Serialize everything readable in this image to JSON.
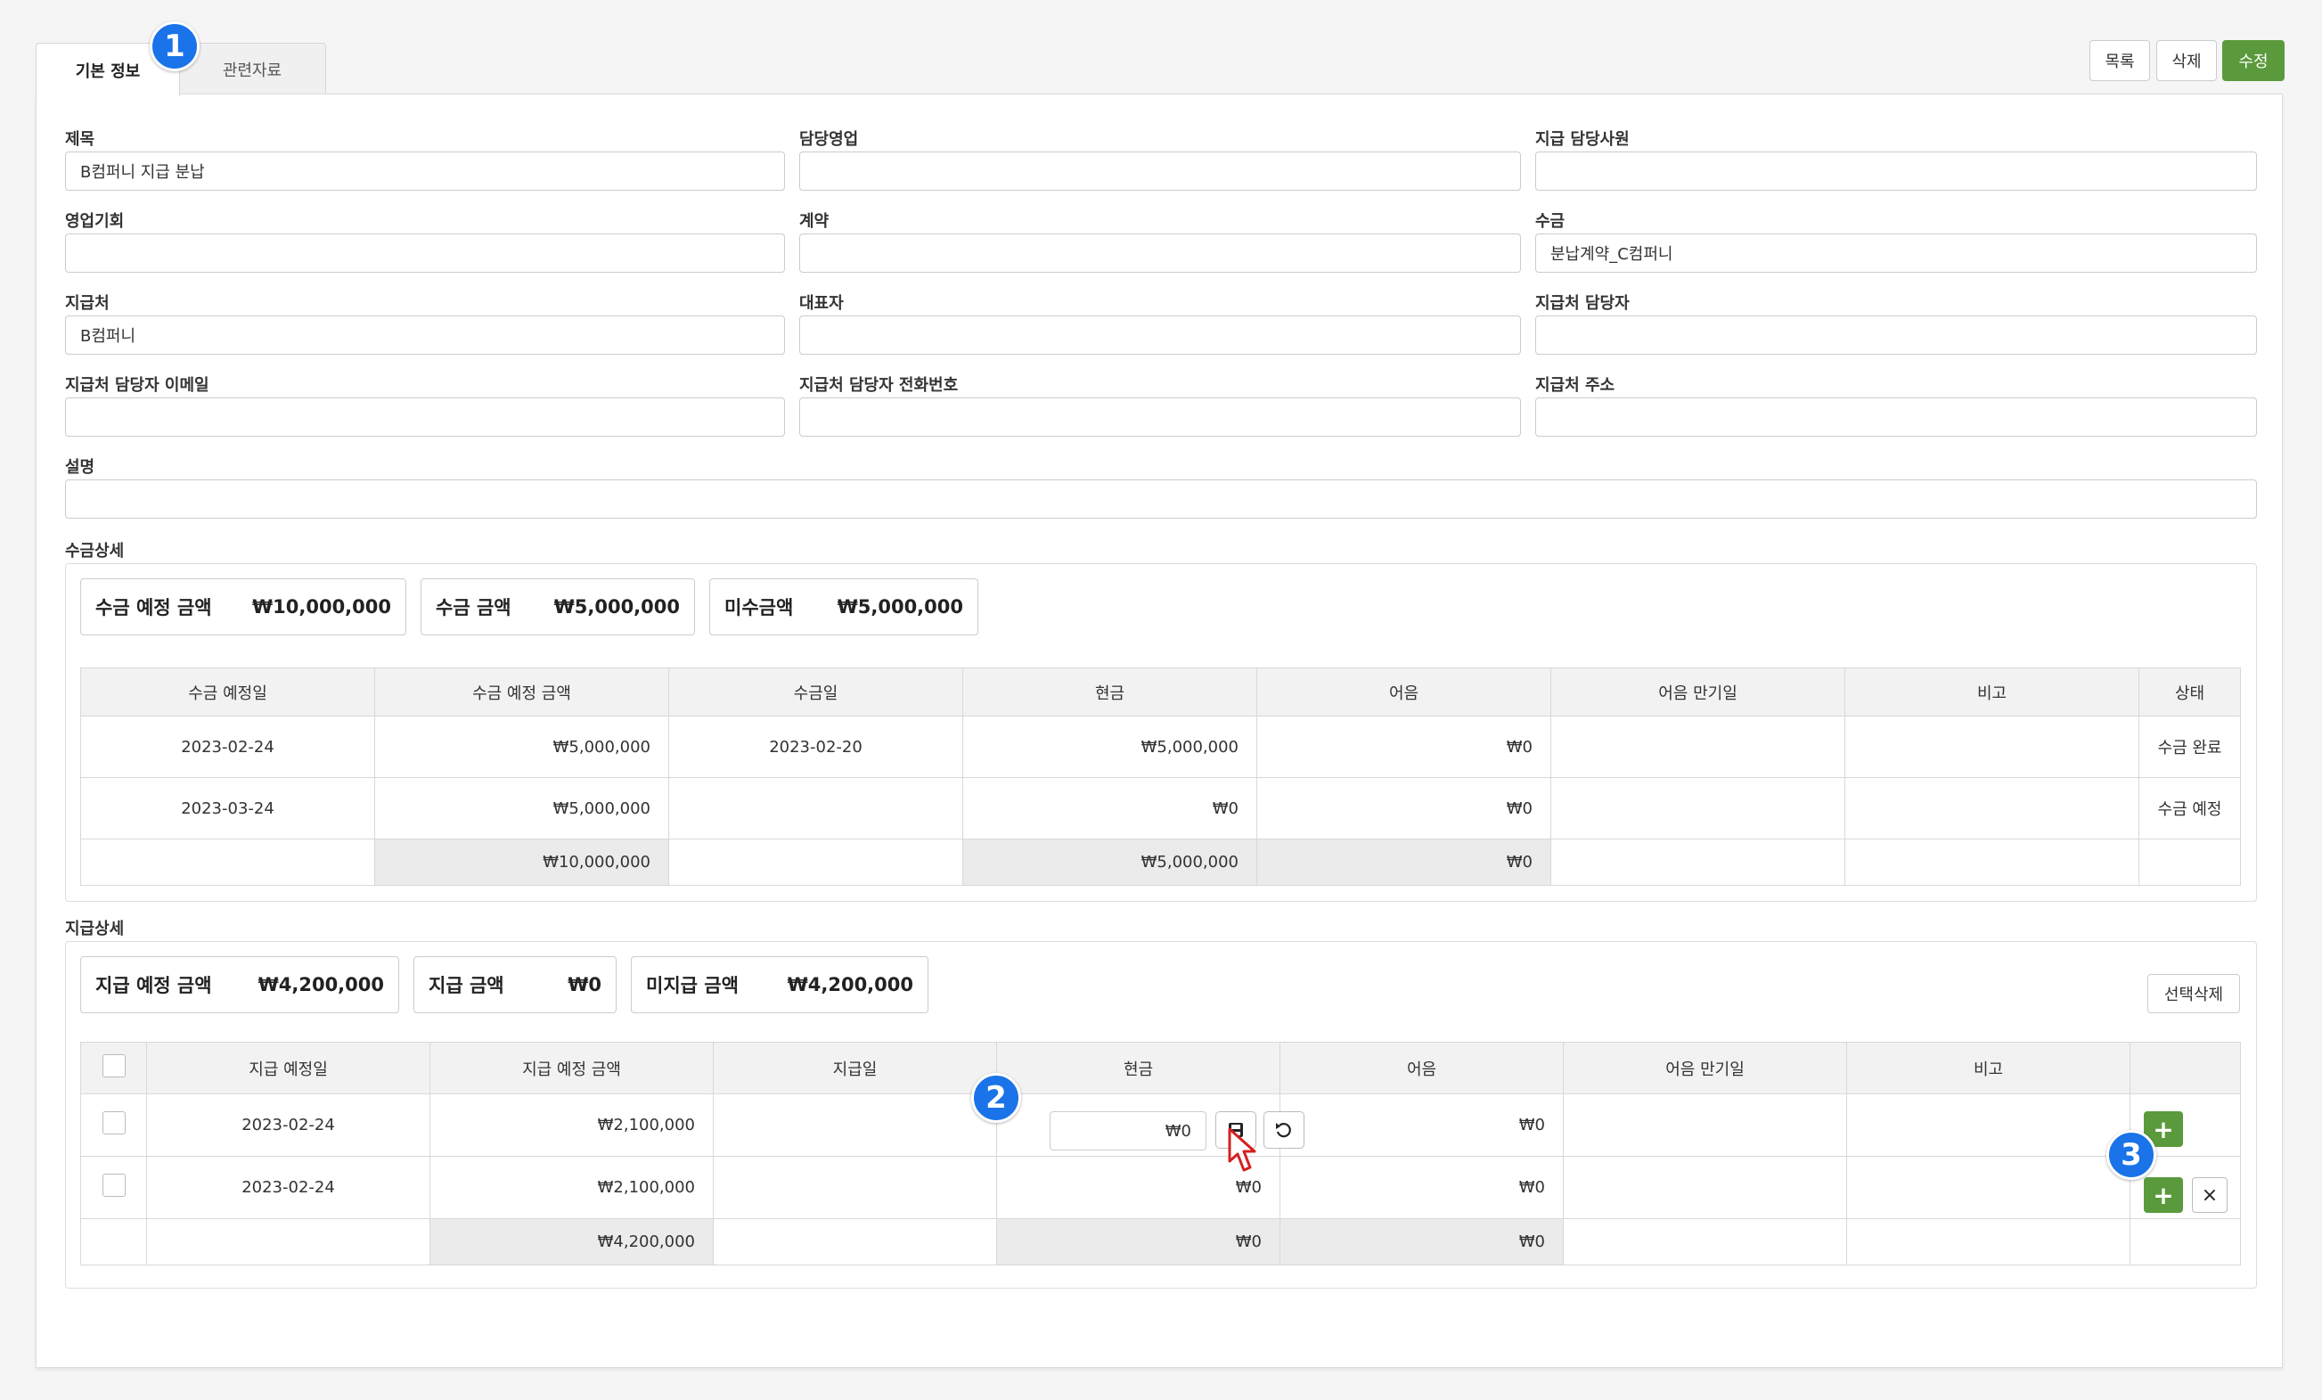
{
  "tabs": {
    "basic": "기본 정보",
    "related": "관련자료"
  },
  "badges": [
    "1",
    "2",
    "3"
  ],
  "toolbar": {
    "list": "목록",
    "delete": "삭제",
    "edit": "수정"
  },
  "form": {
    "title_label": "제목",
    "title_value": "B컴퍼니 지급 분납",
    "sales_rep_label": "담당영업",
    "sales_rep_value": "",
    "pay_staff_label": "지급 담당사원",
    "pay_staff_value": "",
    "opportunity_label": "영업기회",
    "opportunity_value": "",
    "contract_label": "계약",
    "contract_value": "",
    "receipt_label": "수금",
    "receipt_value": "분납계약_C컴퍼니",
    "payee_label": "지급처",
    "payee_value": "B컴퍼니",
    "ceo_label": "대표자",
    "ceo_value": "",
    "payee_contact_label": "지급처 담당자",
    "payee_contact_value": "",
    "payee_email_label": "지급처 담당자 이메일",
    "payee_email_value": "",
    "payee_phone_label": "지급처 담당자 전화번호",
    "payee_phone_value": "",
    "payee_addr_label": "지급처 주소",
    "payee_addr_value": "",
    "desc_label": "설명",
    "desc_value": ""
  },
  "receipt_detail": {
    "section_label": "수금상세",
    "summary": [
      {
        "label": "수금 예정 금액",
        "value": "₩10,000,000"
      },
      {
        "label": "수금 금액",
        "value": "₩5,000,000"
      },
      {
        "label": "미수금액",
        "value": "₩5,000,000"
      }
    ],
    "headers": [
      "수금 예정일",
      "수금 예정 금액",
      "수금일",
      "현금",
      "어음",
      "어음 만기일",
      "비고",
      "상태"
    ],
    "rows": [
      [
        "2023-02-24",
        "₩5,000,000",
        "2023-02-20",
        "₩5,000,000",
        "₩0",
        "",
        "",
        "수금 완료"
      ],
      [
        "2023-03-24",
        "₩5,000,000",
        "",
        "₩0",
        "₩0",
        "",
        "",
        "수금 예정"
      ]
    ],
    "totals": [
      "",
      "₩10,000,000",
      "",
      "₩5,000,000",
      "₩0",
      "",
      "",
      ""
    ]
  },
  "payment_detail": {
    "section_label": "지급상세",
    "summary": [
      {
        "label": "지급 예정 금액",
        "value": "₩4,200,000"
      },
      {
        "label": "지급 금액",
        "value": "₩0"
      },
      {
        "label": "미지급 금액",
        "value": "₩4,200,000"
      }
    ],
    "select_delete": "선택삭제",
    "headers": [
      "",
      "지급 예정일",
      "지급 예정 금액",
      "지급일",
      "현금",
      "어음",
      "어음 만기일",
      "비고",
      ""
    ],
    "rows": [
      [
        "",
        "2023-02-24",
        "₩2,100,000",
        "",
        "₩0",
        "₩0",
        "",
        "",
        ""
      ],
      [
        "",
        "2023-02-24",
        "₩2,100,000",
        "",
        "₩0",
        "₩0",
        "",
        "",
        ""
      ]
    ],
    "totals": [
      "",
      "",
      "₩4,200,000",
      "",
      "₩0",
      "₩0",
      "",
      "",
      ""
    ],
    "edit_cash_value": "₩0"
  },
  "icons": {
    "save": "save-icon",
    "undo": "undo-icon",
    "add": "plus-icon",
    "remove": "close-icon",
    "cursor": "pointer-cursor-icon"
  },
  "colors": {
    "primary_green": "#5a9a3c",
    "badge_blue": "#1a73e8"
  }
}
